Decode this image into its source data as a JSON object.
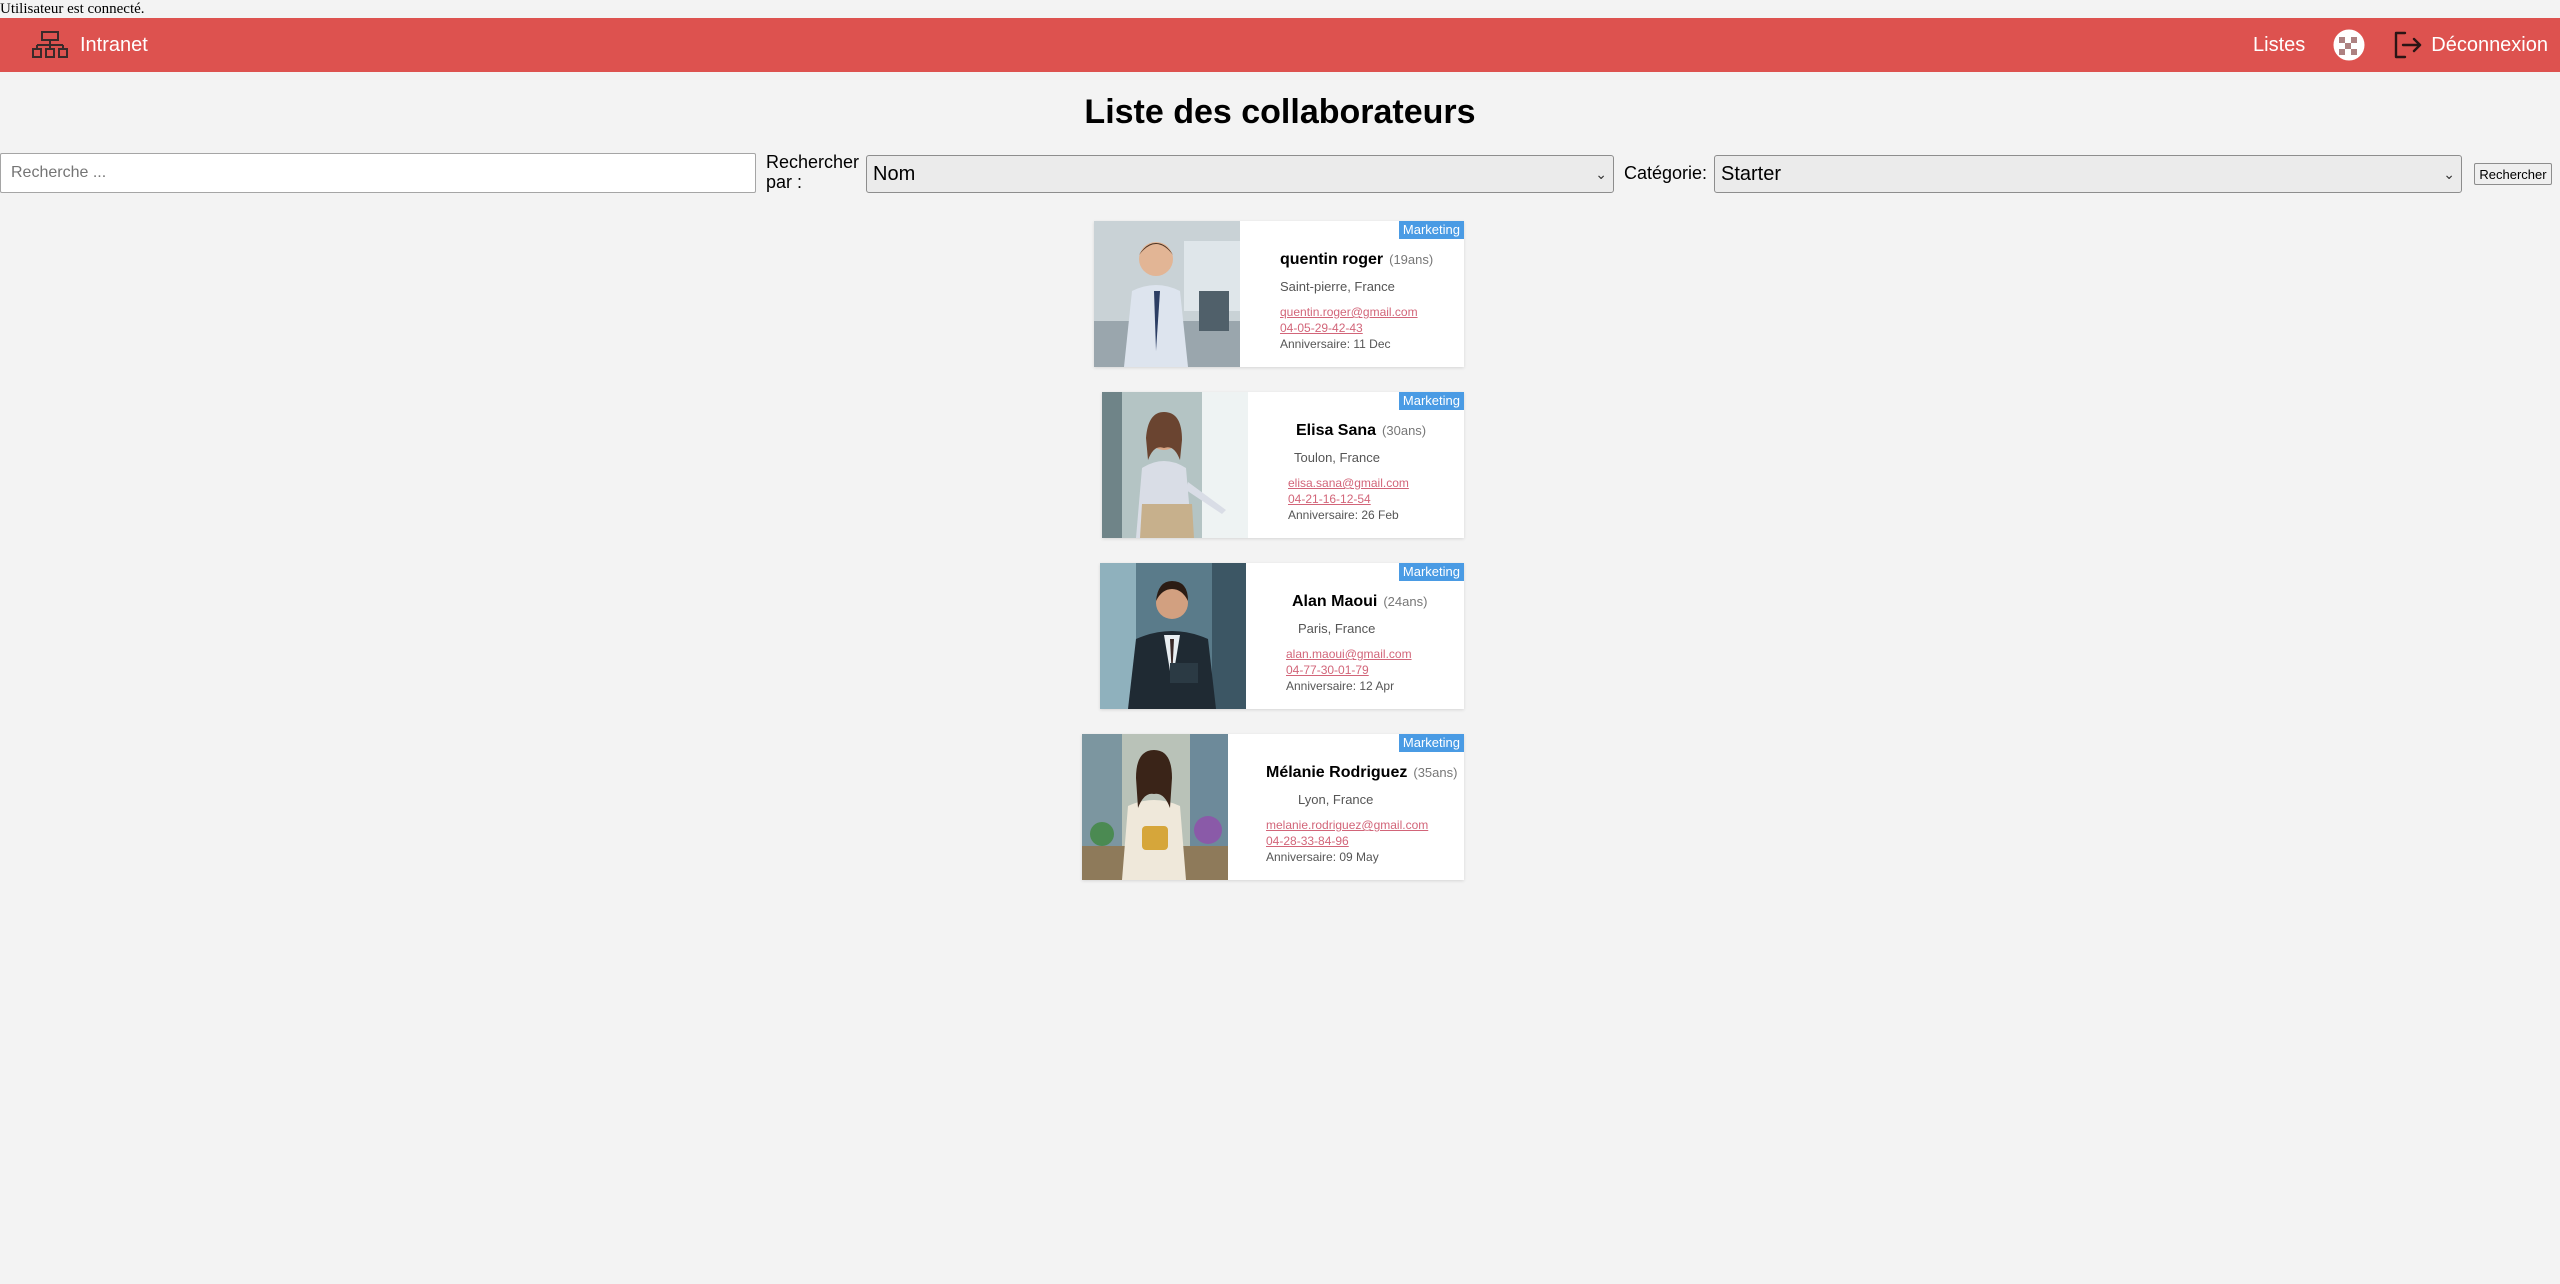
{
  "status": "Utilisateur est connecté.",
  "nav": {
    "brand": "Intranet",
    "lists": "Listes",
    "logout": "Déconnexion"
  },
  "page": {
    "title": "Liste des collaborateurs"
  },
  "search": {
    "placeholder": "Recherche ...",
    "by_label": "Rechercher par :",
    "by_value": "Nom",
    "category_label": "Catégorie:",
    "category_value": "Starter",
    "button": "Rechercher"
  },
  "cards": [
    {
      "name": "quentin roger",
      "age": "(19ans)",
      "location": "Saint-pierre, France",
      "email": "quentin.roger@gmail.com",
      "phone": "04-05-29-42-43",
      "birthday": "Anniversaire: 11 Dec",
      "badge": "Marketing"
    },
    {
      "name": "Elisa Sana",
      "age": "(30ans)",
      "location": "Toulon, France",
      "email": "elisa.sana@gmail.com",
      "phone": "04-21-16-12-54",
      "birthday": "Anniversaire: 26 Feb",
      "badge": "Marketing"
    },
    {
      "name": "Alan Maoui",
      "age": "(24ans)",
      "location": "Paris, France",
      "email": "alan.maoui@gmail.com",
      "phone": "04-77-30-01-79",
      "birthday": "Anniversaire: 12 Apr",
      "badge": "Marketing"
    },
    {
      "name": "Mélanie Rodriguez",
      "age": "(35ans)",
      "location": "Lyon, France",
      "email": "melanie.rodriguez@gmail.com",
      "phone": "04-28-33-84-96",
      "birthday": "Anniversaire: 09 May",
      "badge": "Marketing"
    }
  ],
  "colors": {
    "navbar": "#dd524f",
    "badge": "#4a9be4",
    "link": "#d26579",
    "background": "#f3f3f3"
  }
}
